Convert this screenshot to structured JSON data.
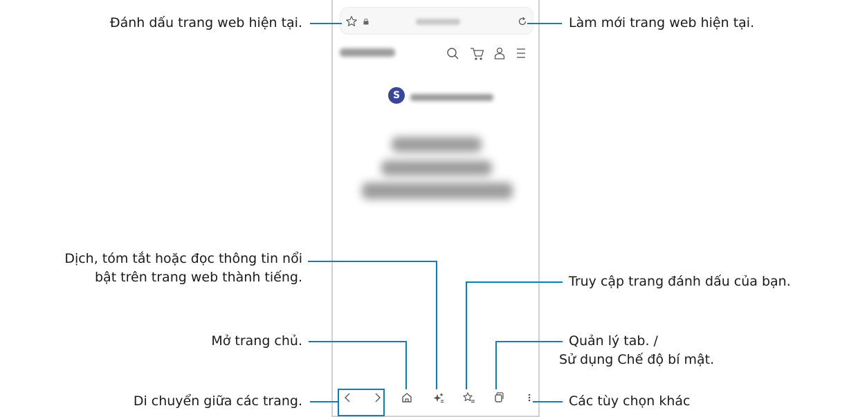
{
  "callouts": {
    "bookmark_current": "Đánh dấu trang web hiện tại.",
    "refresh": "Làm mới trang web hiện tại.",
    "translate_line1": "Dịch, tóm tắt hoặc đọc thông tin nổi",
    "translate_line2": "bật trên trang web thành tiếng.",
    "bookmarks_access": "Truy cập trang đánh dấu của bạn.",
    "home": "Mở trang chủ.",
    "tabs_line1": "Quản lý tab. /",
    "tabs_line2": "Sử dụng Chế độ bí mật.",
    "navigate": "Di chuyển giữa các trang.",
    "more": "Các tùy chọn khác"
  },
  "phone": {
    "badge_letter": "S"
  },
  "icons": {
    "bookmark_star": "star-outline-icon",
    "lock": "lock-icon",
    "reload": "reload-icon",
    "search": "search-icon",
    "cart": "cart-icon",
    "account": "person-icon",
    "menu": "hamburger-menu-icon",
    "back": "chevron-left-icon",
    "forward": "chevron-right-icon",
    "home": "home-icon",
    "ai": "sparkle-icon",
    "bookmarks": "star-list-icon",
    "tabs": "tabs-icon",
    "more": "vertical-dots-icon"
  },
  "colors": {
    "leader_line": "#0081b9",
    "badge": "#3a4699"
  }
}
